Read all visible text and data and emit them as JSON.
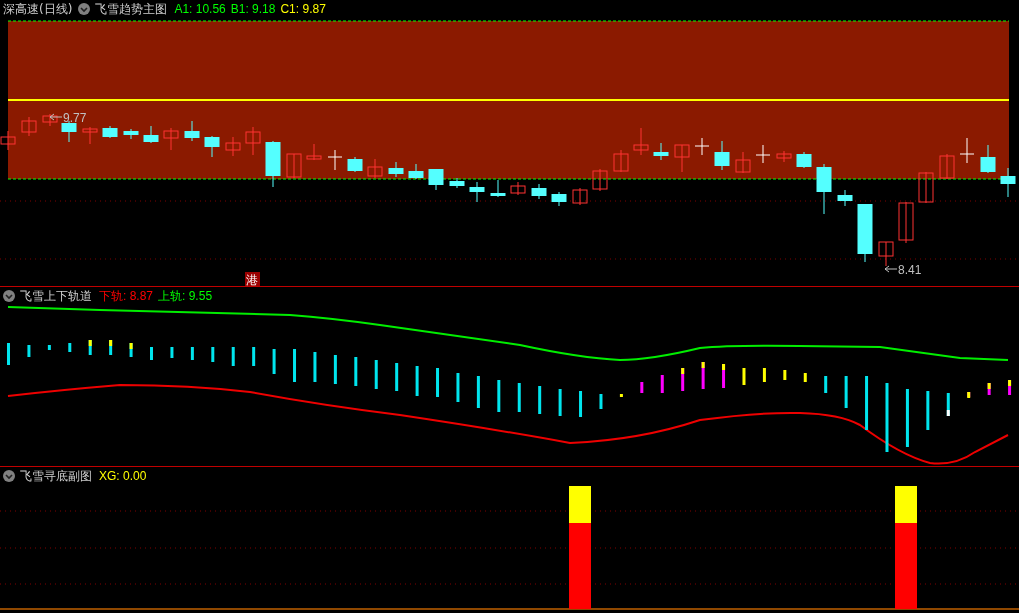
{
  "main_panel": {
    "security": "深高速(日线)",
    "indicator": "飞雪趋势主图",
    "values": [
      {
        "text": "A1: 10.56",
        "color": "#00ff00"
      },
      {
        "text": "B1: 9.18",
        "color": "#00ff00"
      },
      {
        "text": "C1: 9.87",
        "color": "#ffff00"
      }
    ],
    "high_label": "9.77",
    "low_label": "8.41",
    "badge": "港"
  },
  "channel_panel": {
    "indicator": "飞雪上下轨道",
    "values": [
      {
        "text": "下轨: 8.87",
        "color": "#ff0000"
      },
      {
        "text": "上轨: 9.55",
        "color": "#00ff00"
      }
    ]
  },
  "bottom_panel": {
    "indicator": "飞雪寻底副图",
    "values": [
      {
        "text": "XG: 0.00",
        "color": "#ffff00"
      }
    ]
  }
}
